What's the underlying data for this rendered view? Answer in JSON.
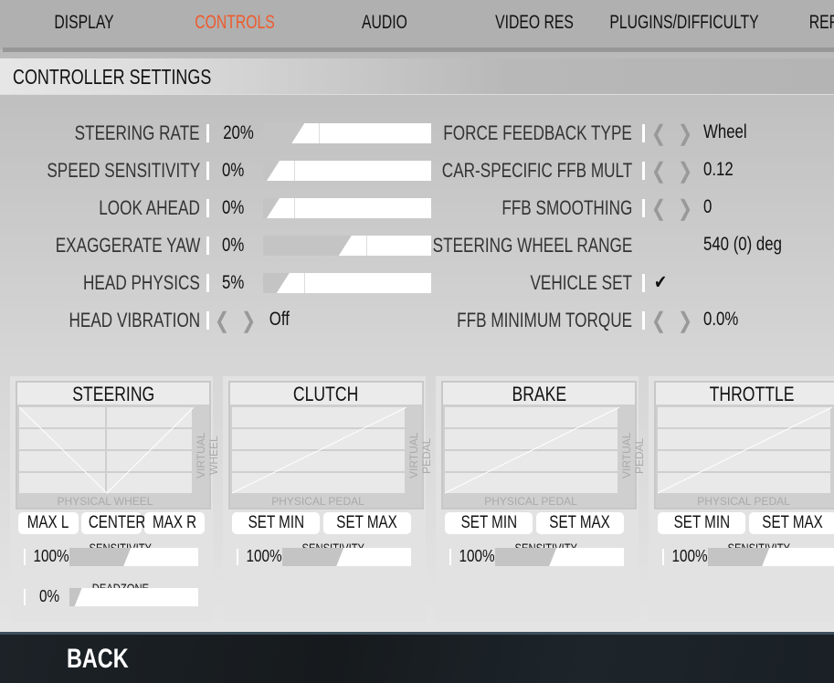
{
  "tabs": [
    {
      "label": "DISPLAY"
    },
    {
      "label": "CONTROLS",
      "active": true
    },
    {
      "label": "AUDIO"
    },
    {
      "label": "VIDEO RES"
    },
    {
      "label": "PLUGINS/DIFFICULTY"
    },
    {
      "label": "REP"
    }
  ],
  "accent_color": "#ee5a2c",
  "section_title": "CONTROLLER SETTINGS",
  "left_settings": [
    {
      "label": "STEERING RATE",
      "value": "20%",
      "slider_fill": 0.17
    },
    {
      "label": "SPEED SENSITIVITY",
      "value": "0%",
      "slider_fill": 0.02
    },
    {
      "label": "LOOK AHEAD",
      "value": "0%",
      "slider_fill": 0.02
    },
    {
      "label": "EXAGGERATE YAW",
      "value": "0%",
      "slider_fill": 0.45
    },
    {
      "label": "HEAD PHYSICS",
      "value": "5%",
      "slider_fill": 0.08
    },
    {
      "label": "HEAD VIBRATION",
      "value": "Off",
      "type": "selector"
    }
  ],
  "right_settings": [
    {
      "label": "FORCE FEEDBACK TYPE",
      "value": "Wheel",
      "type": "selector"
    },
    {
      "label": "CAR-SPECIFIC FFB MULT",
      "value": "0.12",
      "type": "selector"
    },
    {
      "label": "FFB SMOOTHING",
      "value": "0",
      "type": "selector"
    },
    {
      "label": "STEERING WHEEL RANGE",
      "value": "540 (0) deg",
      "type": "text"
    },
    {
      "label": "VEHICLE SET",
      "value": "✔",
      "type": "check"
    },
    {
      "label": "FFB MINIMUM TORQUE",
      "value": "0.0%",
      "type": "selector"
    }
  ],
  "panels": [
    {
      "title": "STEERING",
      "xlabel": "PHYSICAL WHEEL",
      "ylabel": "VIRTUAL WHEEL",
      "buttons": [
        "MAX L",
        "CENTER",
        "MAX R"
      ],
      "sensitivity_label": "SENSITIVITY",
      "sensitivity": "100%",
      "sensitivity_fill": 0.42,
      "deadzone_label": "DEADZONE",
      "deadzone": "0%",
      "deadzone_fill": 0.04
    },
    {
      "title": "CLUTCH",
      "xlabel": "PHYSICAL PEDAL",
      "ylabel": "VIRTUAL PEDAL",
      "buttons": [
        "SET MIN",
        "SET MAX"
      ],
      "sensitivity_label": "SENSITIVITY",
      "sensitivity": "100%",
      "sensitivity_fill": 0.42
    },
    {
      "title": "BRAKE",
      "xlabel": "PHYSICAL PEDAL",
      "ylabel": "VIRTUAL PEDAL",
      "buttons": [
        "SET MIN",
        "SET MAX"
      ],
      "sensitivity_label": "SENSITIVITY",
      "sensitivity": "100%",
      "sensitivity_fill": 0.42
    },
    {
      "title": "THROTTLE",
      "xlabel": "PHYSICAL PEDAL",
      "ylabel": "VIRTUAL PEDAL",
      "buttons": [
        "SET MIN",
        "SET MAX"
      ],
      "sensitivity_label": "SENSITIVITY",
      "sensitivity": "100%",
      "sensitivity_fill": 0.42
    }
  ],
  "back_label": "BACK",
  "icons": {
    "prev": "chevron-left-icon",
    "next": "chevron-right-icon",
    "check": "checkmark-icon"
  }
}
